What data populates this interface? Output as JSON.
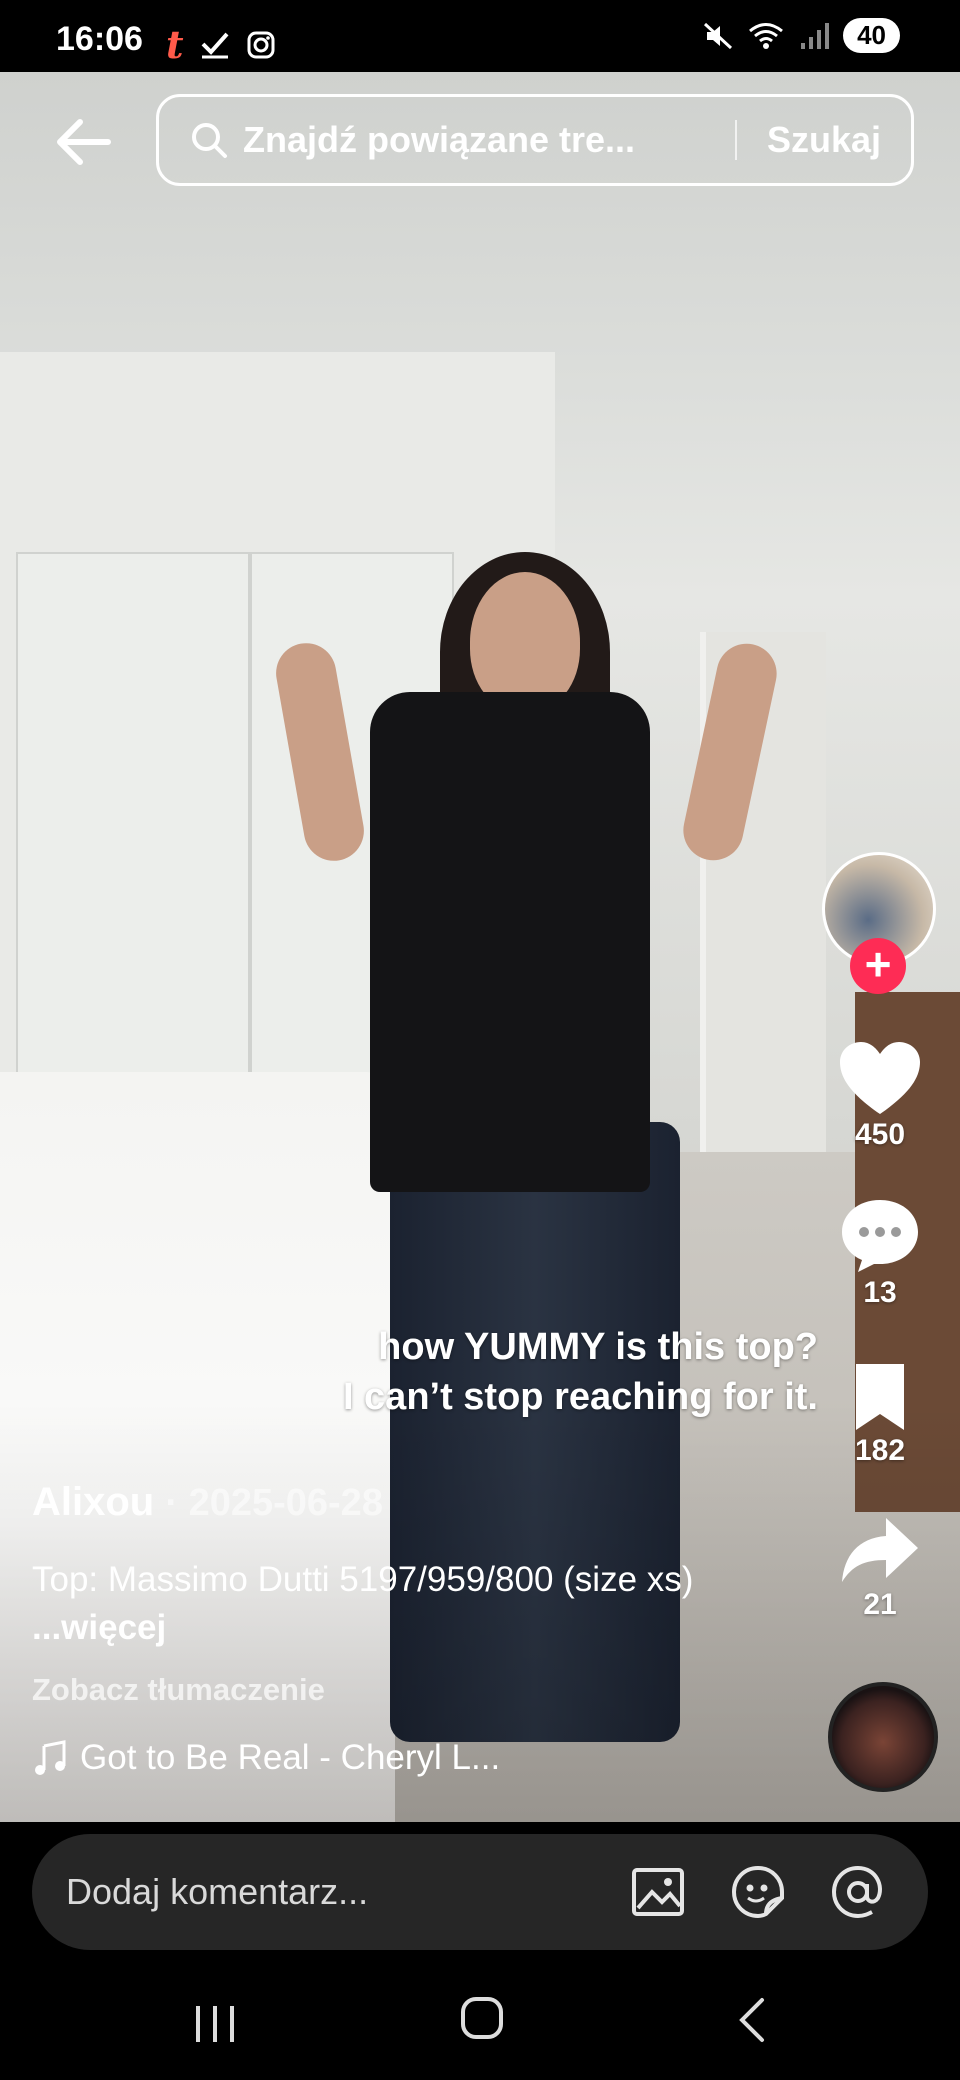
{
  "status_bar": {
    "time": "16:06",
    "left_icons": [
      "t-app-icon",
      "check-icon",
      "instagram-icon"
    ],
    "right_icons": [
      "mute-icon",
      "wifi-icon",
      "signal-icon"
    ],
    "battery": "40"
  },
  "search": {
    "placeholder": "Znajdź powiązane tre...",
    "button_label": "Szukaj"
  },
  "caption": {
    "line1": "how YUMMY is this top?",
    "line2": "I can’t stop reaching for it."
  },
  "actions": {
    "likes": "450",
    "comments": "13",
    "saves": "182",
    "shares": "21"
  },
  "post": {
    "author": "Alixou",
    "date": "· 2025-06-28",
    "description": "Top: Massimo Dutti 5197/959/800 (size xs)",
    "more": " ...więcej",
    "translate": "Zobacz tłumaczenie",
    "music": "Got to Be Real - Cheryl L..."
  },
  "comment_bar": {
    "placeholder": "Dodaj komentarz..."
  },
  "colors": {
    "accent": "#fe2c55",
    "comment_bar_bg": "#262626"
  }
}
